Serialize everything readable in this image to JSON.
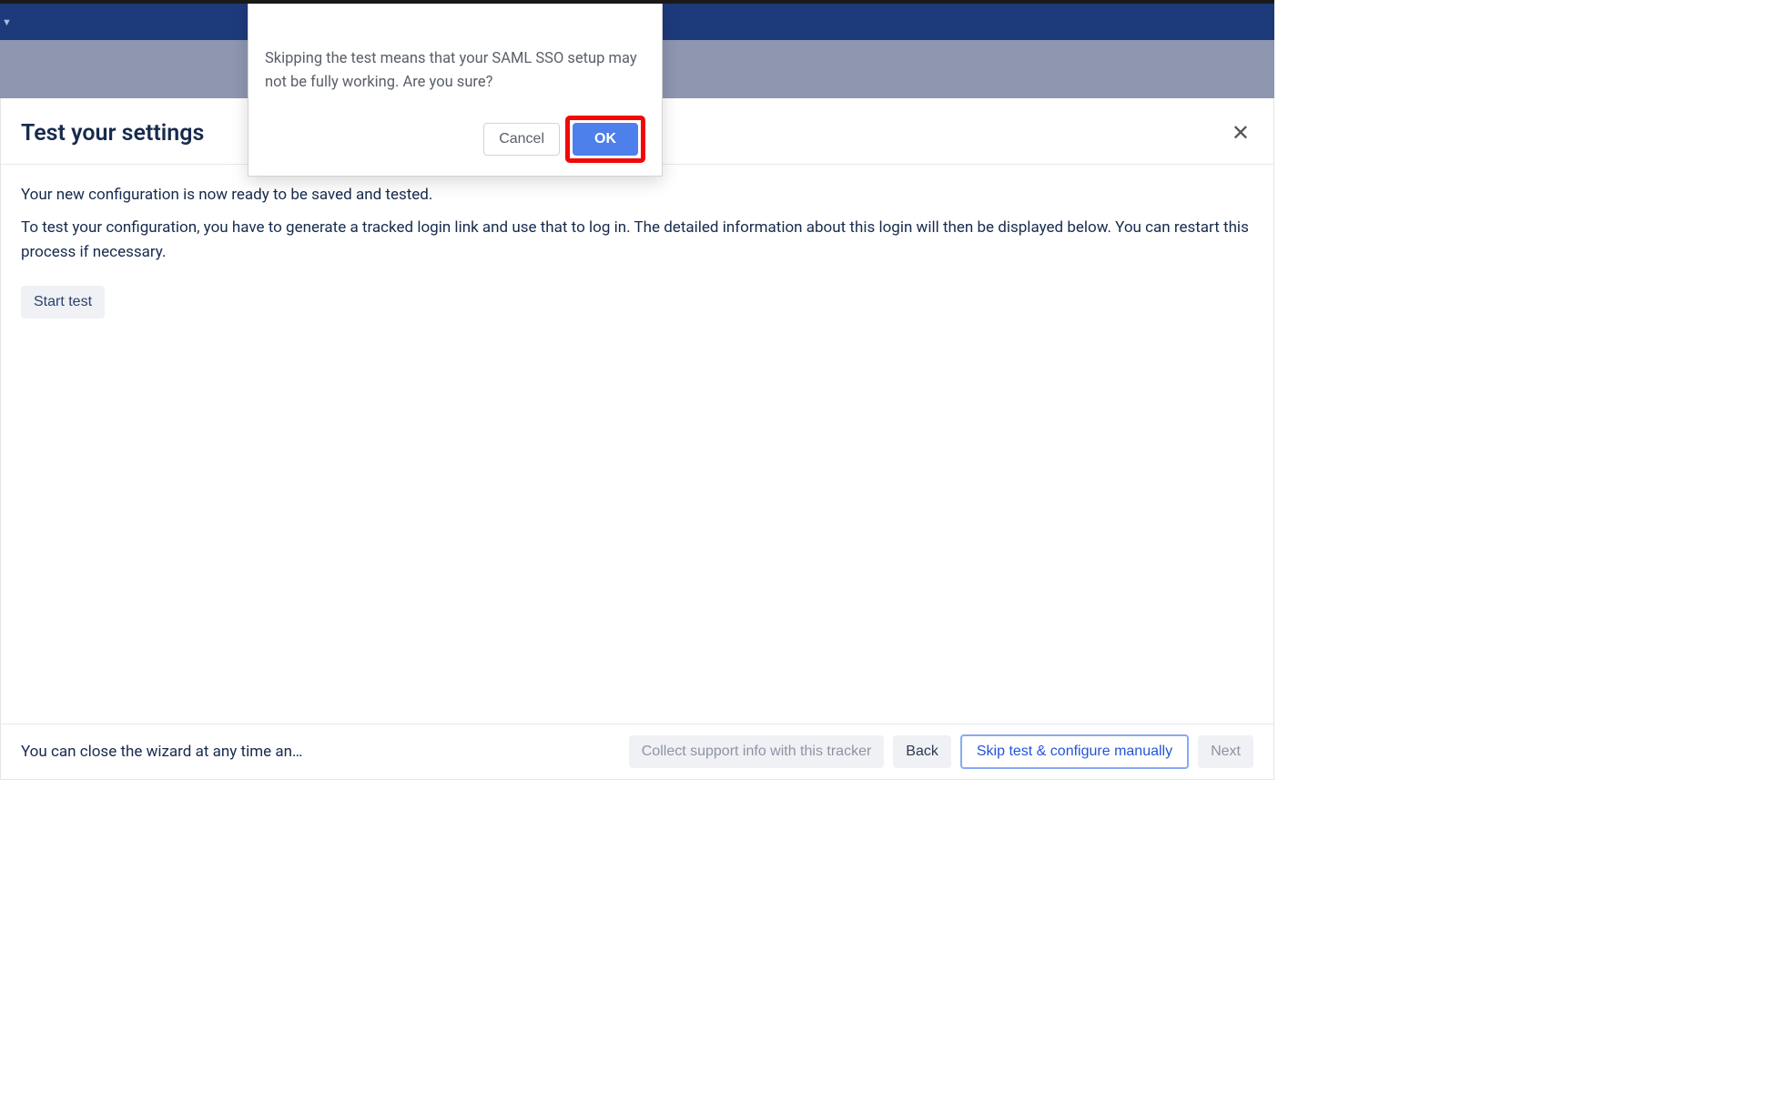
{
  "header": {
    "title": "Test your settings"
  },
  "body": {
    "line1": "Your new configuration is now ready to be saved and tested.",
    "line2": "To test your configuration, you have to generate a tracked login link and use that to log in. The detailed information about this login will then be displayed below. You can restart this process if necessary.",
    "start_test_label": "Start test"
  },
  "footer": {
    "close_text": "You can close the wizard at any time and con...",
    "collect_label": "Collect support info with this tracker",
    "back_label": "Back",
    "skip_label": "Skip test & configure manually",
    "next_label": "Next"
  },
  "modal": {
    "message": "Skipping the test means that your SAML SSO setup may not be fully working. Are you sure?",
    "cancel_label": "Cancel",
    "ok_label": "OK"
  }
}
